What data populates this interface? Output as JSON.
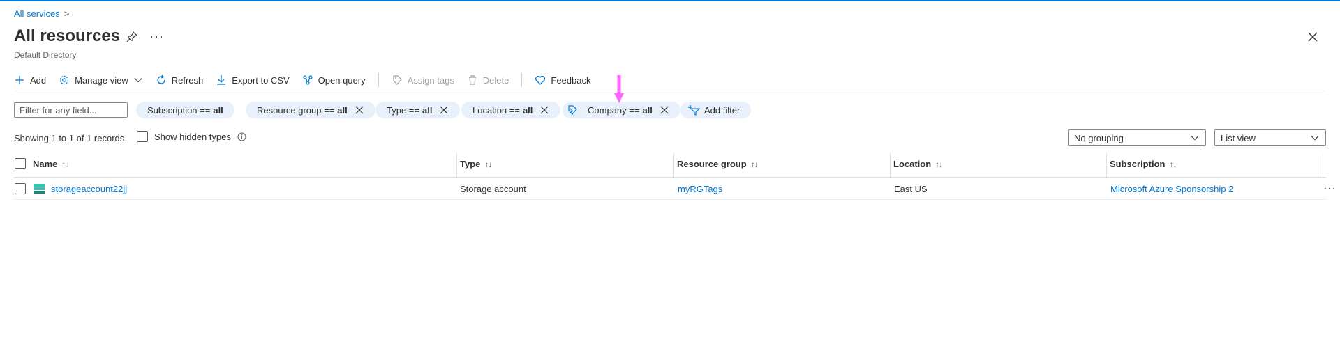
{
  "breadcrumb": {
    "root": "All services",
    "separator": ">"
  },
  "header": {
    "title": "All resources",
    "subtitle": "Default Directory",
    "more": "···"
  },
  "toolbar": {
    "add": "Add",
    "manage_view": "Manage view",
    "refresh": "Refresh",
    "export_csv": "Export to CSV",
    "open_query": "Open query",
    "assign_tags": "Assign tags",
    "delete": "Delete",
    "feedback": "Feedback"
  },
  "filters": {
    "placeholder": "Filter for any field...",
    "subscription": {
      "name": "Subscription ==",
      "value": "all"
    },
    "resource_group": {
      "name": "Resource group ==",
      "value": "all"
    },
    "type": {
      "name": "Type ==",
      "value": "all"
    },
    "location": {
      "name": "Location ==",
      "value": "all"
    },
    "company": {
      "name": "Company ==",
      "value": "all"
    },
    "add_filter": "Add filter"
  },
  "records": {
    "showing": "Showing 1 to 1 of 1 records.",
    "show_hidden": "Show hidden types"
  },
  "grouping": {
    "selected": "No grouping"
  },
  "view": {
    "selected": "List view"
  },
  "table": {
    "columns": [
      "Name",
      "Type",
      "Resource group",
      "Location",
      "Subscription"
    ],
    "rows": [
      {
        "name": "storageaccount22jj",
        "type": "Storage account",
        "resource_group": "myRGTags",
        "location": "East US",
        "subscription": "Microsoft Azure Sponsorship 2"
      }
    ],
    "row_more": "···"
  },
  "colors": {
    "accent": "#0078d4",
    "pill_bg": "#e8f1fb",
    "annotation_arrow": "#ff66ff"
  }
}
